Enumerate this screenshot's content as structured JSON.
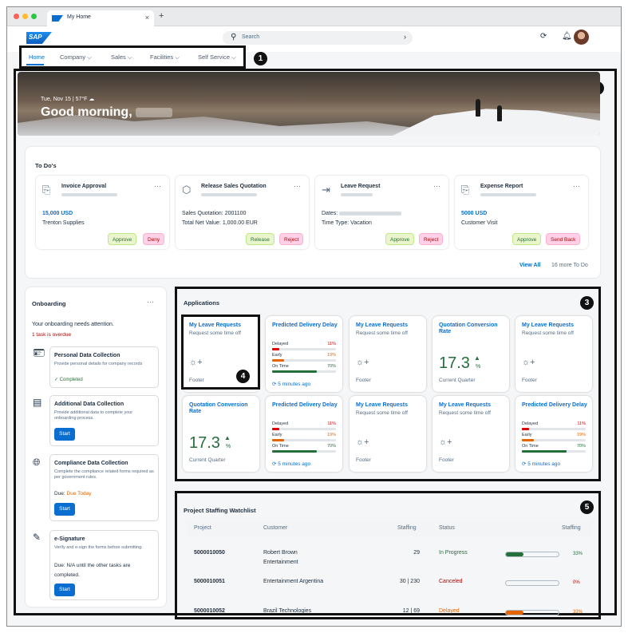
{
  "browser": {
    "tab_title": "My Home",
    "close": "×",
    "new_tab": "+",
    "tab_logo": "SAP"
  },
  "shell": {
    "logo": "SAP",
    "search_placeholder": "Search",
    "search_arrow": "›",
    "icon_names": [
      "refresh-icon",
      "bell-icon",
      "avatar"
    ]
  },
  "nav": {
    "items": [
      "Home",
      "Company",
      "Sales",
      "Facilities",
      "Self Service"
    ],
    "chevron": "⌵"
  },
  "callouts": [
    "1",
    "2",
    "3",
    "4",
    "5"
  ],
  "hero": {
    "date": "Tue, Nov 15 | 57°F",
    "greeting": "Good morning,"
  },
  "todos": {
    "title": "To Do's",
    "items": [
      {
        "title": "Invoice Approval",
        "line1": "15,000 USD",
        "line2": "Trenton Supplies",
        "buttons": [
          "Approve",
          "Deny"
        ]
      },
      {
        "title": "Release Sales Quotation",
        "line1": "Sales Quotation: 2001100",
        "line2": "Total Net Value: 1,000.00 EUR",
        "buttons": [
          "Release",
          "Reject"
        ]
      },
      {
        "title": "Leave Request",
        "line1": "Dates:",
        "line2": "Time Type: Vacation",
        "buttons": [
          "Approve",
          "Reject"
        ]
      },
      {
        "title": "Expense Report",
        "line1": "5000 USD",
        "line2": "Customer Visit",
        "buttons": [
          "Approve",
          "Send Back"
        ]
      }
    ],
    "more": "···",
    "view_all": "View All",
    "more_count": "16 more To Do"
  },
  "onboarding": {
    "title": "Onboarding",
    "attention": "Your onboarding needs attention.",
    "overdue": "1 task is overdue",
    "steps": [
      {
        "title": "Personal Data Collection",
        "desc": "Provide personal details for company records",
        "status": "Completed"
      },
      {
        "title": "Additional Data Collection",
        "desc": "Provide additional data to complete your onboarding process.",
        "button": "Start"
      },
      {
        "title": "Compliance Data Collection",
        "desc": "Complete the compliance related forms required as per government rules.",
        "due_label": "Due:",
        "due_value": "Due Today",
        "button": "Start"
      },
      {
        "title": "e-Signature",
        "desc": "Verify and e-sign the forms before submitting.",
        "due_label": "Due:",
        "due_value": "N/A until the other tasks are completed.",
        "button": "Start"
      }
    ]
  },
  "applications": {
    "title": "Applications",
    "leave_title": "My Leave Requests",
    "leave_sub": "Request some time off",
    "footer": "Footer",
    "delivery_title": "Predicted Delivery Delay",
    "delivery_rows": [
      {
        "label": "Delayed",
        "pct": "11%",
        "color": "#e00000",
        "value": 11
      },
      {
        "label": "Early",
        "pct": "19%",
        "color": "#e76500",
        "value": 19
      },
      {
        "label": "On Time",
        "pct": "70%",
        "color": "#256f3a",
        "value": 70
      }
    ],
    "delivery_ago": "5 minutes ago",
    "quote_title": "Quotation Conversion Rate",
    "quote_value": "17.3",
    "quote_unit": "%",
    "quote_footer": "Current Quarter"
  },
  "watchlist": {
    "title": "Project Staffing Watchlist",
    "headers": [
      "Project",
      "Customer",
      "Staffing",
      "Status",
      "Staffing"
    ],
    "rows": [
      {
        "project": "5000010050",
        "customer": "Robert Brown Entertainment",
        "staffing": "29",
        "status": "In Progress",
        "status_color": "#256f3a",
        "pct": "33%",
        "fill": 0.33,
        "fill_color": "#256f3a"
      },
      {
        "project": "5000010051",
        "customer": "Entertainment Argentina",
        "staffing": "30 | 230",
        "status": "Canceled",
        "status_color": "#aa0808",
        "pct": "0%",
        "fill": 0,
        "fill_color": "#aa0808"
      },
      {
        "project": "5000010052",
        "customer": "Brazil Technologies",
        "staffing": "12 | 69",
        "status": "Delayed",
        "status_color": "#e76500",
        "pct": "33%",
        "fill": 0.33,
        "fill_color": "#e76500"
      }
    ]
  }
}
